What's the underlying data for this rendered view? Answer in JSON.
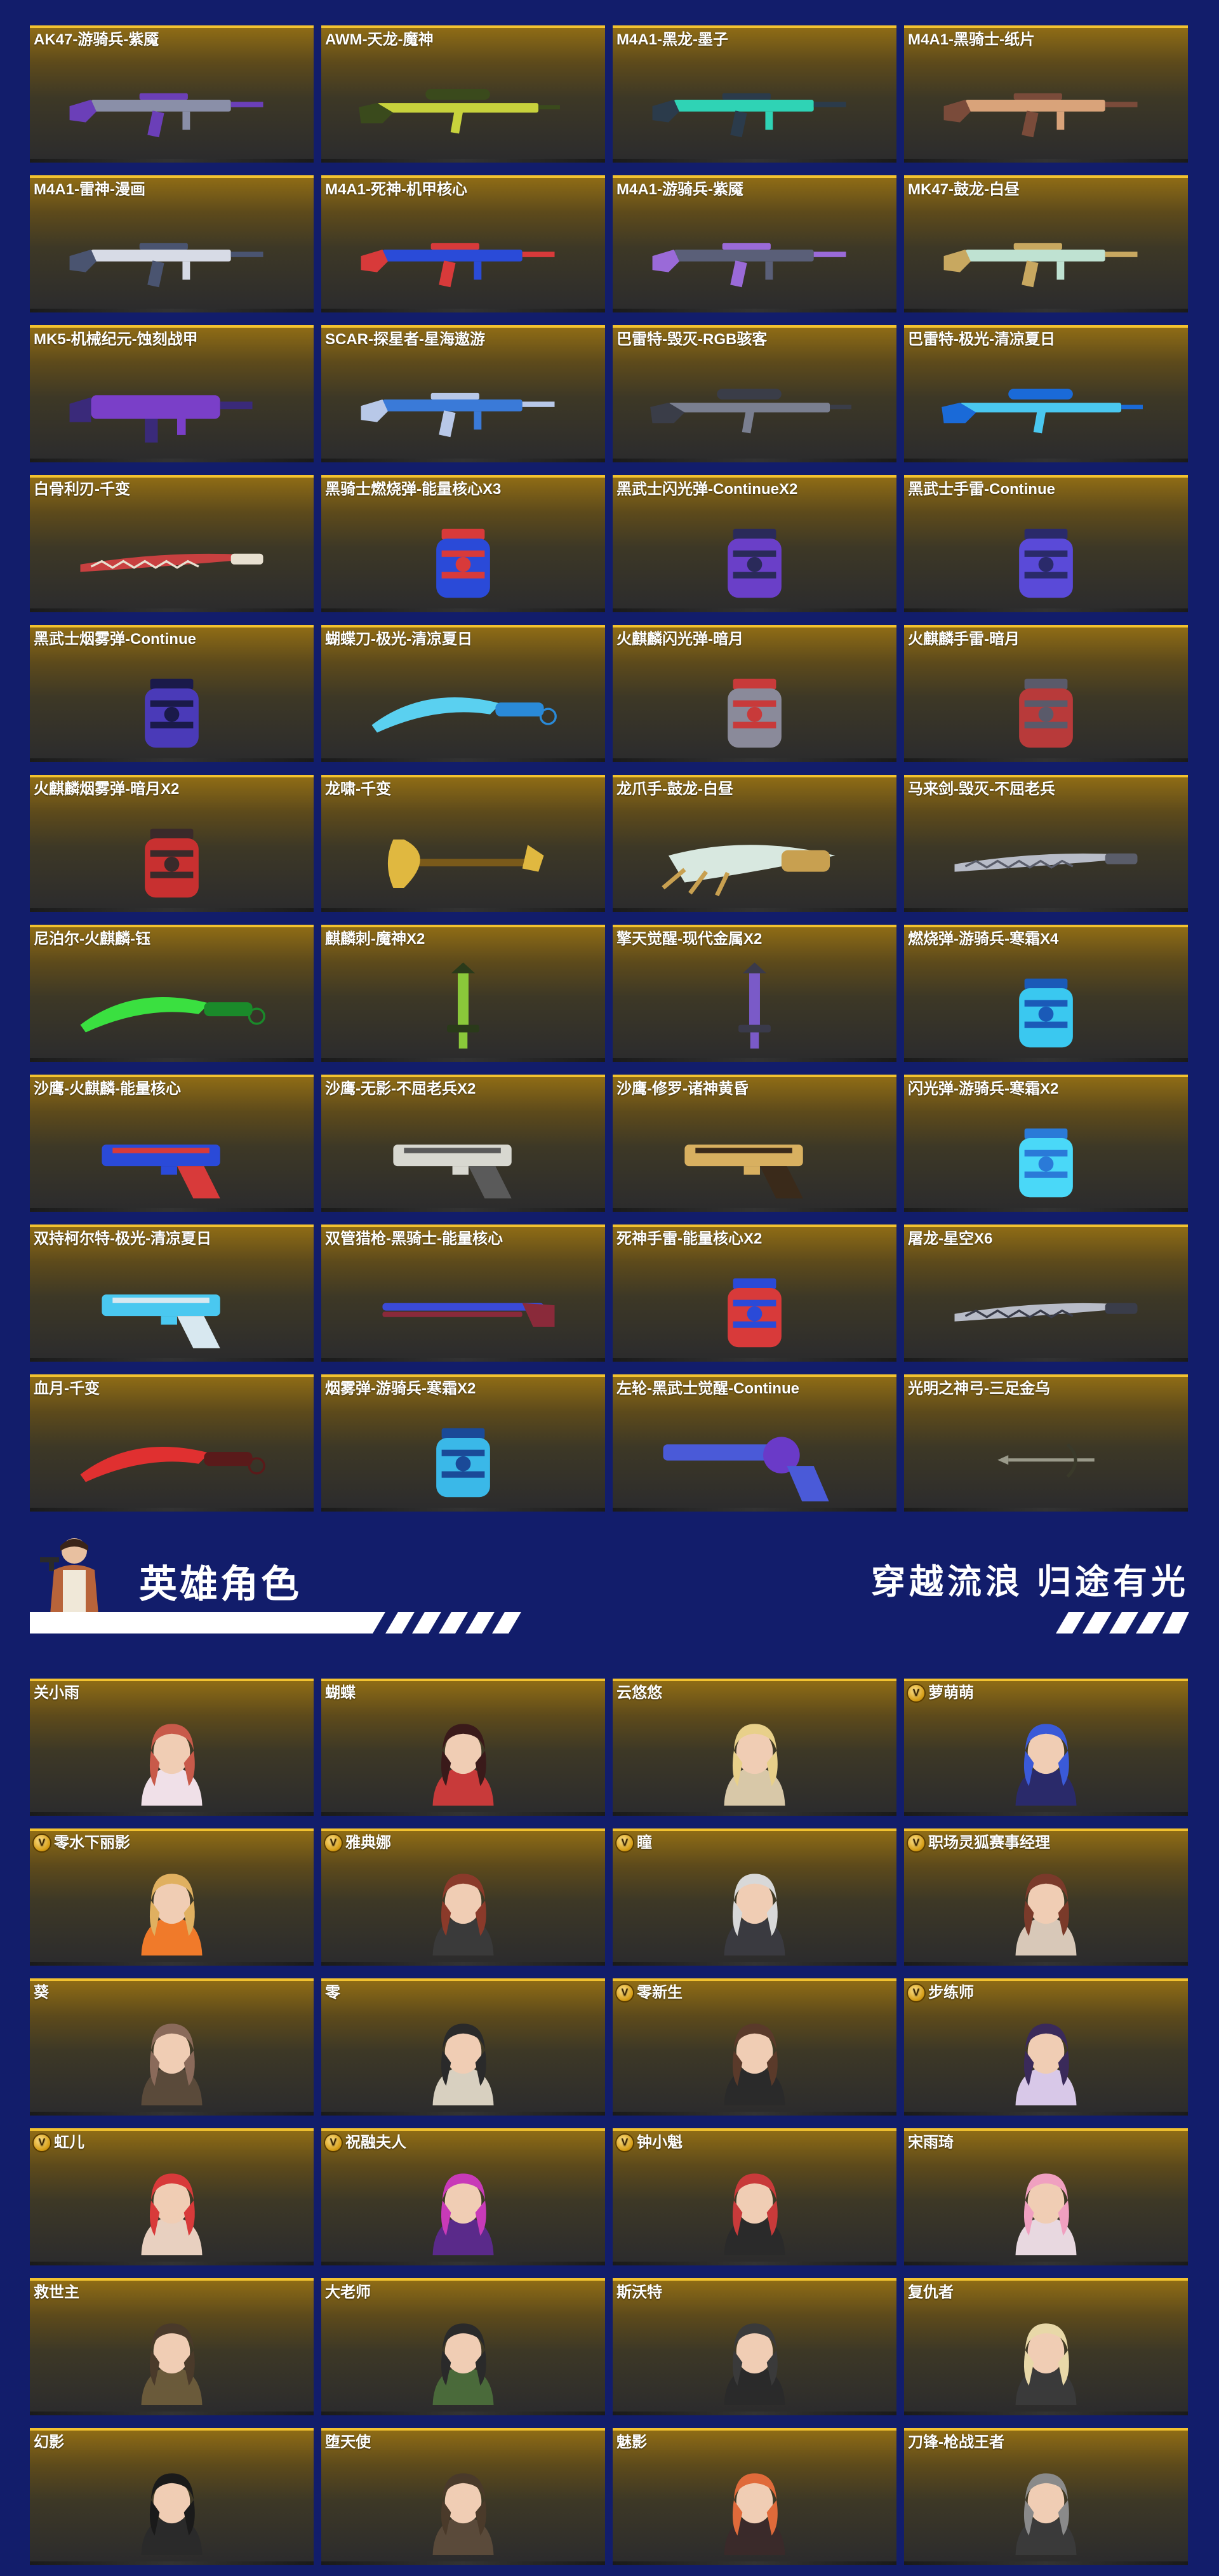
{
  "weapons": [
    {
      "name": "AK47-游骑兵-紫魇",
      "art": "rifle",
      "colors": [
        "#8a8fa8",
        "#6b3fb8"
      ]
    },
    {
      "name": "AWM-天龙-魔神",
      "art": "sniper",
      "colors": [
        "#c8d23c",
        "#3a4a1c"
      ]
    },
    {
      "name": "M4A1-黑龙-墨子",
      "art": "rifle",
      "colors": [
        "#2fd3b5",
        "#2b3b4b"
      ]
    },
    {
      "name": "M4A1-黑骑士-纸片",
      "art": "rifle",
      "colors": [
        "#d9a37a",
        "#7a4b3a"
      ]
    },
    {
      "name": "M4A1-雷神-漫画",
      "art": "rifle",
      "colors": [
        "#d7dbe6",
        "#4a5470"
      ]
    },
    {
      "name": "M4A1-死神-机甲核心",
      "art": "rifle",
      "colors": [
        "#2a4bd8",
        "#d83a3a"
      ]
    },
    {
      "name": "M4A1-游骑兵-紫魇",
      "art": "rifle",
      "colors": [
        "#5a5f78",
        "#9a6ad8"
      ]
    },
    {
      "name": "MK47-鼓龙-白昼",
      "art": "rifle",
      "colors": [
        "#bfe2d2",
        "#c8a860"
      ]
    },
    {
      "name": "MK5-机械纪元-蚀刻战甲",
      "art": "smg",
      "colors": [
        "#7a3fc8",
        "#3a2a7a"
      ]
    },
    {
      "name": "SCAR-探星者-星海遨游",
      "art": "rifle",
      "colors": [
        "#3a7ad8",
        "#b8c8e8"
      ]
    },
    {
      "name": "巴雷特-毁灭-RGB骇客",
      "art": "sniper",
      "colors": [
        "#7a7f90",
        "#3a3d48"
      ]
    },
    {
      "name": "巴雷特-极光-清凉夏日",
      "art": "sniper",
      "colors": [
        "#4ac8f0",
        "#1a6ad8"
      ]
    },
    {
      "name": "白骨利刃-千变",
      "art": "blade",
      "colors": [
        "#c84040",
        "#e8e0d0"
      ]
    },
    {
      "name": "黑骑士燃烧弹-能量核心X3",
      "art": "grenade",
      "colors": [
        "#2a4ad8",
        "#d83a3a"
      ]
    },
    {
      "name": "黑武士闪光弹-ContinueX2",
      "art": "grenade",
      "colors": [
        "#6a3fc8",
        "#2a2a5a"
      ]
    },
    {
      "name": "黑武士手雷-Continue",
      "art": "grenade",
      "colors": [
        "#5a4ad8",
        "#2a2a6a"
      ]
    },
    {
      "name": "黑武士烟雾弹-Continue",
      "art": "grenade",
      "colors": [
        "#4a3ab8",
        "#1a1a4a"
      ]
    },
    {
      "name": "蝴蝶刀-极光-清凉夏日",
      "art": "knife",
      "colors": [
        "#5ad0f0",
        "#2a8ad8"
      ]
    },
    {
      "name": "火麒麟闪光弹-暗月",
      "art": "grenade",
      "colors": [
        "#8a8a9a",
        "#c83a3a"
      ]
    },
    {
      "name": "火麒麟手雷-暗月",
      "art": "grenade",
      "colors": [
        "#b83a3a",
        "#5a5a6a"
      ]
    },
    {
      "name": "火麒麟烟雾弹-暗月X2",
      "art": "grenade",
      "colors": [
        "#c83030",
        "#3a2a2a"
      ]
    },
    {
      "name": "龙啸-千变",
      "art": "axe",
      "colors": [
        "#e0b840",
        "#7a5a1a"
      ]
    },
    {
      "name": "龙爪手-鼓龙-白昼",
      "art": "claw",
      "colors": [
        "#d8e8e0",
        "#c8a050"
      ]
    },
    {
      "name": "马来剑-毁灭-不屈老兵",
      "art": "blade",
      "colors": [
        "#b8bcc8",
        "#5a5d6a"
      ]
    },
    {
      "name": "尼泊尔-火麒麟-钰",
      "art": "knife",
      "colors": [
        "#3ae040",
        "#1a8a2a"
      ]
    },
    {
      "name": "麒麟刺-魔神X2",
      "art": "dagger",
      "colors": [
        "#8ac83a",
        "#2a3a1a"
      ]
    },
    {
      "name": "擎天觉醒-现代金属X2",
      "art": "dagger",
      "colors": [
        "#7a5ac8",
        "#3a3a4a"
      ]
    },
    {
      "name": "燃烧弹-游骑兵-寒霜X4",
      "art": "grenade",
      "colors": [
        "#3ac8f0",
        "#1a5ab8"
      ]
    },
    {
      "name": "沙鹰-火麒麟-能量核心",
      "art": "pistol",
      "colors": [
        "#2a4ad8",
        "#d83a3a"
      ]
    },
    {
      "name": "沙鹰-无影-不屈老兵X2",
      "art": "pistol",
      "colors": [
        "#d8d8d0",
        "#5a5a5a"
      ]
    },
    {
      "name": "沙鹰-修罗-诸神黄昏",
      "art": "pistol",
      "colors": [
        "#d8b060",
        "#3a2a1a"
      ]
    },
    {
      "name": "闪光弹-游骑兵-寒霜X2",
      "art": "grenade",
      "colors": [
        "#4ad8f8",
        "#2a7ad8"
      ]
    },
    {
      "name": "双持柯尔特-极光-清凉夏日",
      "art": "pistol",
      "colors": [
        "#4ac8f0",
        "#d8e8f0"
      ]
    },
    {
      "name": "双管猎枪-黑骑士-能量核心",
      "art": "shotgun",
      "colors": [
        "#3a4ad8",
        "#8a2a3a"
      ]
    },
    {
      "name": "死神手雷-能量核心X2",
      "art": "grenade",
      "colors": [
        "#d83a3a",
        "#2a4ad8"
      ]
    },
    {
      "name": "屠龙-星空X6",
      "art": "blade",
      "colors": [
        "#b8bcc8",
        "#3a3d4a"
      ]
    },
    {
      "name": "血月-千变",
      "art": "knife",
      "colors": [
        "#e03030",
        "#5a1a1a"
      ]
    },
    {
      "name": "烟雾弹-游骑兵-寒霜X2",
      "art": "grenade",
      "colors": [
        "#3ab8e8",
        "#1a4a98"
      ]
    },
    {
      "name": "左轮-黑武士觉醒-Continue",
      "art": "revolver",
      "colors": [
        "#4a5ad8",
        "#6a3ac8"
      ]
    },
    {
      "name": "光明之神弓-三足金乌",
      "art": "bow",
      "colors": [
        "#9a9a8a",
        "#3a3a2a"
      ]
    }
  ],
  "hero_section": {
    "title": "英雄角色",
    "slogan": "穿越流浪 归途有光",
    "accent": "#ffffff"
  },
  "heroes": [
    {
      "name": "关小雨",
      "vip": false,
      "hair": "#c85a4a",
      "outfit": "#f0e0e8"
    },
    {
      "name": "蝴蝶",
      "vip": false,
      "hair": "#3a1a1a",
      "outfit": "#c83a3a"
    },
    {
      "name": "云悠悠",
      "vip": false,
      "hair": "#e8d08a",
      "outfit": "#d8c8a8"
    },
    {
      "name": "萝萌萌",
      "vip": true,
      "hair": "#3a5ad8",
      "outfit": "#2a2a6a"
    },
    {
      "name": "零水下丽影",
      "vip": true,
      "hair": "#e0b060",
      "outfit": "#f07a2a"
    },
    {
      "name": "雅典娜",
      "vip": true,
      "hair": "#8a3a2a",
      "outfit": "#3a3a3a"
    },
    {
      "name": "瞳",
      "vip": true,
      "hair": "#d8d8d8",
      "outfit": "#3a3a40"
    },
    {
      "name": "职场灵狐赛事经理",
      "vip": true,
      "hair": "#7a3a2a",
      "outfit": "#d8c8b8"
    },
    {
      "name": "葵",
      "vip": false,
      "hair": "#8a6a5a",
      "outfit": "#5a4a3a"
    },
    {
      "name": "零",
      "vip": false,
      "hair": "#2a2a2a",
      "outfit": "#d8d0c0"
    },
    {
      "name": "零新生",
      "vip": true,
      "hair": "#5a3a2a",
      "outfit": "#2a2a2a"
    },
    {
      "name": "步练师",
      "vip": true,
      "hair": "#3a2a5a",
      "outfit": "#d8c8e8"
    },
    {
      "name": "虹儿",
      "vip": true,
      "hair": "#d83a3a",
      "outfit": "#e8d0c0"
    },
    {
      "name": "祝融夫人",
      "vip": true,
      "hair": "#c83ab8",
      "outfit": "#5a2a8a"
    },
    {
      "name": "钟小魁",
      "vip": true,
      "hair": "#c83a3a",
      "outfit": "#2a2a2a"
    },
    {
      "name": "宋雨琦",
      "vip": false,
      "hair": "#f0a0c0",
      "outfit": "#e8d8e0"
    },
    {
      "name": "救世主",
      "vip": false,
      "hair": "#4a3a2a",
      "outfit": "#6a5a3a"
    },
    {
      "name": "大老师",
      "vip": false,
      "hair": "#2a2a2a",
      "outfit": "#4a6a3a"
    },
    {
      "name": "斯沃特",
      "vip": false,
      "hair": "#3a3a3a",
      "outfit": "#2a2a2a"
    },
    {
      "name": "复仇者",
      "vip": false,
      "hair": "#e8d8a8",
      "outfit": "#3a3a3a"
    },
    {
      "name": "幻影",
      "vip": false,
      "hair": "#1a1a1a",
      "outfit": "#2a2a2a"
    },
    {
      "name": "堕天使",
      "vip": false,
      "hair": "#4a3a2a",
      "outfit": "#5a4a3a"
    },
    {
      "name": "魅影",
      "vip": false,
      "hair": "#e06a3a",
      "outfit": "#3a2a2a"
    },
    {
      "name": "刀锋-枪战王者",
      "vip": false,
      "hair": "#8a8a8a",
      "outfit": "#3a3a3a"
    }
  ]
}
